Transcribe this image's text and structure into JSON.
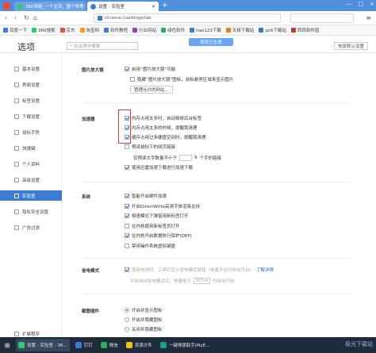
{
  "tabs": [
    {
      "label": "360导航_一个主页，整个世界",
      "active": false
    },
    {
      "label": "设置 - 实验室",
      "active": true
    }
  ],
  "address": {
    "url": "chrome://settings/lab"
  },
  "bookmarks": [
    {
      "label": "百度一下",
      "color": "#3a7bd5"
    },
    {
      "label": "360搜索",
      "color": "#2ecc71"
    },
    {
      "label": "京东",
      "color": "#e74c3c"
    },
    {
      "label": "淘宝网",
      "color": "#f39c12"
    },
    {
      "label": "软件教程",
      "color": "#3a7bd5"
    },
    {
      "label": "行业网站",
      "color": "#8e44ad"
    },
    {
      "label": "绿色软件",
      "color": "#27ae60"
    },
    {
      "label": "hao123下载",
      "color": "#3a7bd5"
    },
    {
      "label": "天极下载站",
      "color": "#e67e22"
    },
    {
      "label": "pc6下载站",
      "color": "#2980b9"
    },
    {
      "label": "西西软件园",
      "color": "#c0392b"
    }
  ],
  "settings": {
    "title": "选项",
    "search_placeholder": "在选项中搜索",
    "saved_label": "修改已生效",
    "restore_label": "恢复默认设置"
  },
  "sidebar": {
    "items": [
      {
        "label": "基本设置",
        "active": false
      },
      {
        "label": "界面设置",
        "active": false
      },
      {
        "label": "标签设置",
        "active": false
      },
      {
        "label": "下载设置",
        "active": false
      },
      {
        "label": "鼠标手势",
        "active": false
      },
      {
        "label": "快捷键",
        "active": false
      },
      {
        "label": "个人资料",
        "active": false
      },
      {
        "label": "高级设置",
        "active": false
      },
      {
        "label": "实验室",
        "active": true
      },
      {
        "label": "隐私安全设置",
        "active": false
      },
      {
        "label": "广告过滤",
        "active": false
      }
    ]
  },
  "lab": {
    "image_zoom": {
      "heading": "图片放大镜",
      "enable": "启用“图片放大镜”功能",
      "hide": "隐藏“图片放大镜”图标，鼠标悬停区域来显示图片",
      "manage_button": "管理允许的网站..."
    },
    "accel": {
      "heading": "加速器",
      "items": [
        {
          "label": "内存占用太多时，自动释放后台标签",
          "checked": true
        },
        {
          "label": "内存占用太多的时候，提醒我清理",
          "checked": true
        },
        {
          "label": "缓存占用过多硬盘空间时，提醒我清理",
          "checked": true
        },
        {
          "label": "预读鼠标下的网页链接",
          "checked": false
        }
      ],
      "threshold_prefix": "仅预读文字数量不小于",
      "threshold_value": "9",
      "threshold_suffix": "个字的链接",
      "download_accel": "使用迅雷加速下载进行加速下载"
    },
    "system": {
      "heading": "系统",
      "items": [
        {
          "label": "智能开启硬件加速",
          "checked": true
        },
        {
          "label": "开启DirectWrite高清字体渲染支持",
          "checked": true
        },
        {
          "label": "极速模式下弹窗用新标签打开",
          "checked": true
        },
        {
          "label": "在内核使用新标签页打开",
          "checked": false
        },
        {
          "label": "在内核开启数据执行保护(DEP)",
          "checked": true
        },
        {
          "label": "禁用操作系统虚拟键盘",
          "checked": false
        }
      ]
    },
    "eye_mode": {
      "heading": "省电模式",
      "enable_text": "使用电池时，工具栏显示省电模式按钮（电量不足时自动开启）",
      "link": "了解详情",
      "sub_prefix": "开启自动省电模式后，电量低于",
      "sub_value": "60%",
      "sub_suffix": "时自动开启"
    },
    "screenshot": {
      "heading": "截图插件",
      "options": [
        {
          "label": "开启并显示图标",
          "checked": true
        },
        {
          "label": "开启并隐藏图标",
          "checked": false
        },
        {
          "label": "关闭并隐藏图标",
          "checked": false
        }
      ]
    },
    "extensions_partial": "扩展程序"
  },
  "taskbar": {
    "items": [
      {
        "label": "设置 - 实验室 - 36...",
        "color": "#2ecc71",
        "active": true
      },
      {
        "label": "钉钉",
        "color": "#3a7bd5",
        "active": false
      },
      {
        "label": "微信",
        "color": "#27ae60",
        "active": false
      },
      {
        "label": "资源文件",
        "color": "#f1c40f",
        "active": false
      },
      {
        "label": "一键排版助手(MyE...",
        "color": "#16a085",
        "active": false
      }
    ],
    "watermark": "极光下载站"
  }
}
